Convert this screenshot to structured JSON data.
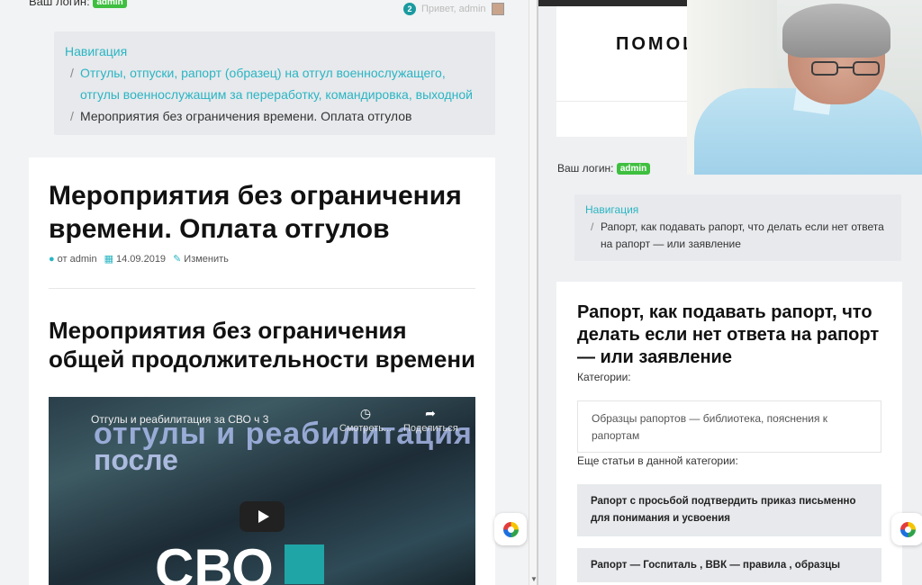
{
  "left": {
    "login_label": "Ваш логин:",
    "login_user": "admin",
    "notif_count": "2",
    "greeting": "Привет, admin",
    "breadcrumb": {
      "root": "Навигация",
      "link": "Отгулы, отпуски, рапорт (образец) на отгул военнослужащего, отгулы военнослужащим за переработку, командировка, выходной",
      "current": "Мероприятия без ограничения времени. Оплата отгулов"
    },
    "article": {
      "title": "Мероприятия без ограничения времени. Оплата отгулов",
      "author": "от admin",
      "date": "14.09.2019",
      "edit": "Изменить",
      "subtitle": "Мероприятия без ограничения общей продолжительности времени"
    },
    "video": {
      "title": "Отгулы и реабилитация за СВО ч 3",
      "overlay_line1": "отгулы и реабилитация",
      "overlay_line2": "после",
      "overlay_big": "СВО",
      "watch_later": "Смотреть...",
      "share": "Поделиться"
    }
  },
  "right": {
    "site_title_line1": "ПОМОЩ",
    "site_title_line2": "Ю",
    "login_label": "Ваш логин:",
    "login_user": "admin",
    "breadcrumb": {
      "root": "Навигация",
      "current": "Рапорт, как подавать рапорт, что делать если нет ответа на рапорт — или заявление"
    },
    "article": {
      "title": "Рапорт, как подавать рапорт, что делать если нет ответа на рапорт — или заявление",
      "categories_label": "Категории:",
      "category": "Образцы рапортов — библиотека, пояснения к рапортам",
      "more_label": "Еще статьи в данной категории:",
      "related": [
        "Рапорт с просьбой подтвердить приказ письменно для понимания и усвоения",
        "Рапорт — Госпиталь , ВВК — правила , образцы"
      ]
    }
  },
  "colors": {
    "accent": "#2ab5c3",
    "badge": "#3fbf3f",
    "breadcrumb_bg": "#e7e9ec"
  }
}
